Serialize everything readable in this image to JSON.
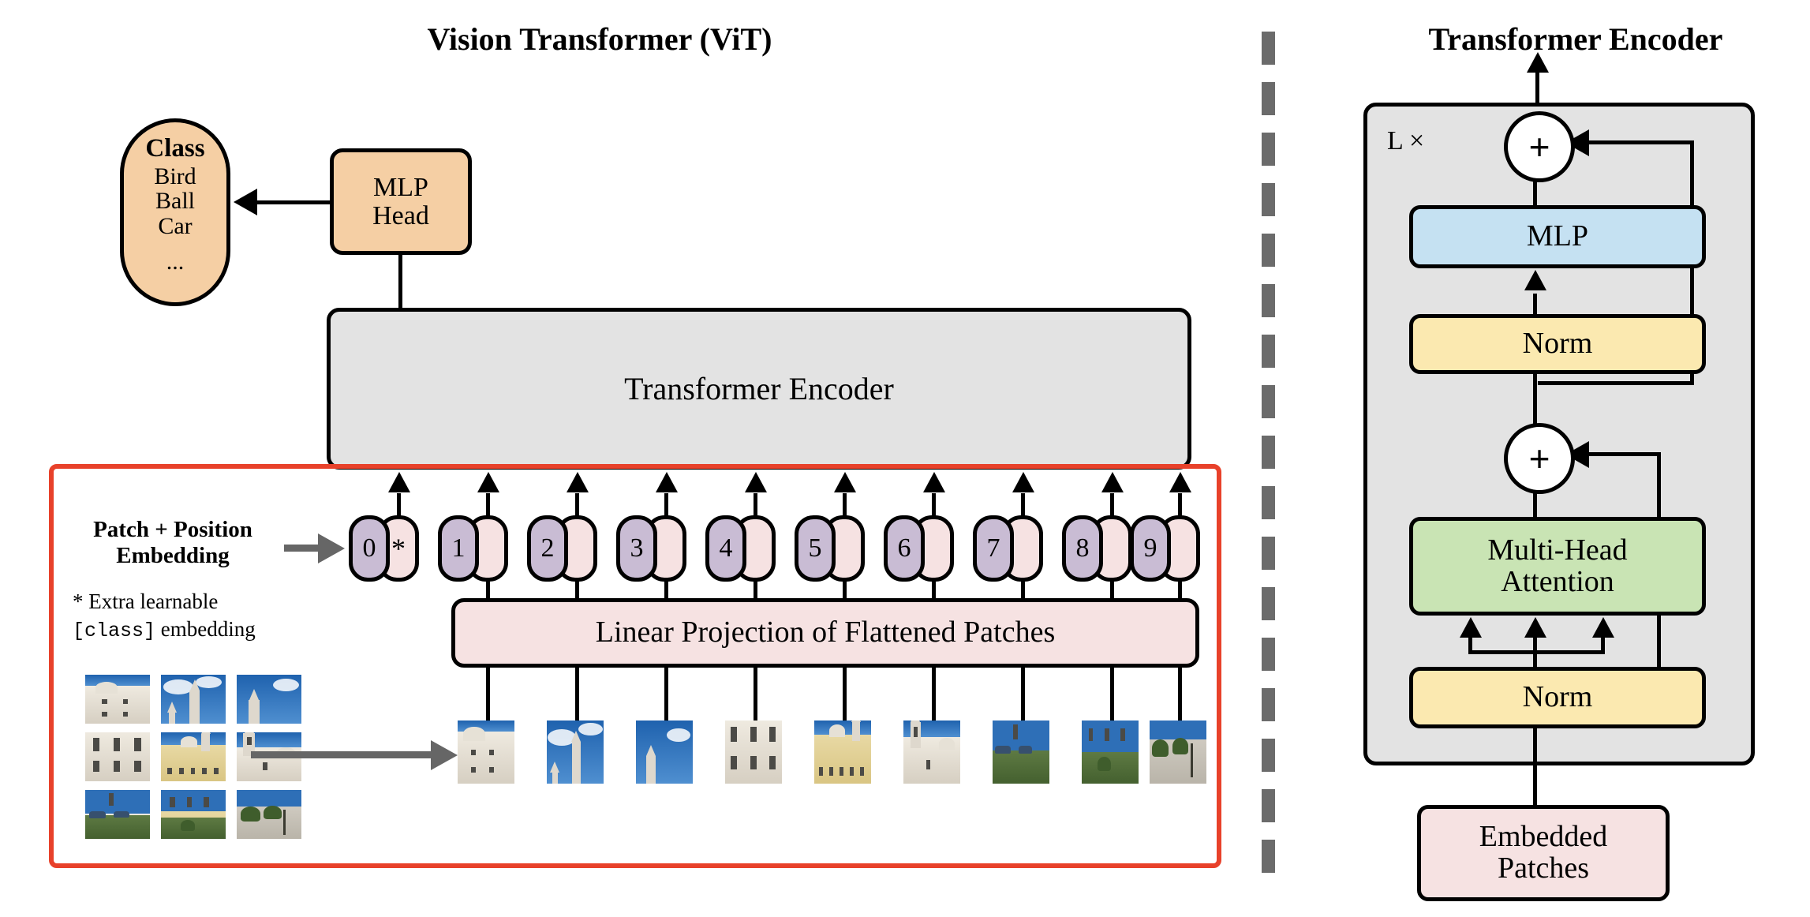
{
  "figure": {
    "left_panel_title": "Vision Transformer (ViT)",
    "right_panel_title": "Transformer Encoder"
  },
  "colors": {
    "orange": "#f5cfa4",
    "pink": "#f6e2e2",
    "gray_box": "#e3e3e3",
    "purple": "#c9bcd4",
    "blue": "#c5e1f2",
    "yellow": "#fbe9b0",
    "green": "#c9e4b4",
    "red_outline": "#e8412a",
    "divider_gray": "#6b6b6b",
    "line_black": "#000000"
  },
  "left": {
    "class_box": {
      "heading": "Class",
      "items": [
        "Bird",
        "Ball",
        "Car"
      ],
      "ellipsis": "..."
    },
    "mlp_head": {
      "line1": "MLP",
      "line2": "Head"
    },
    "transformer_encoder_box": {
      "label": "Transformer Encoder"
    },
    "embedding_label": {
      "line1": "Patch + Position",
      "line2": "Embedding"
    },
    "footnote": {
      "line1_prefix": "* ",
      "line1": "Extra learnable",
      "line2_token": "[class]",
      "line2_rest": " embedding"
    },
    "tokens": [
      {
        "position": "0",
        "patch_mark": "*"
      },
      {
        "position": "1",
        "patch_mark": ""
      },
      {
        "position": "2",
        "patch_mark": ""
      },
      {
        "position": "3",
        "patch_mark": ""
      },
      {
        "position": "4",
        "patch_mark": ""
      },
      {
        "position": "5",
        "patch_mark": ""
      },
      {
        "position": "6",
        "patch_mark": ""
      },
      {
        "position": "7",
        "patch_mark": ""
      },
      {
        "position": "8",
        "patch_mark": ""
      },
      {
        "position": "9",
        "patch_mark": ""
      }
    ],
    "linear_projection": {
      "label": "Linear Projection of Flattened Patches"
    },
    "source_image_alt": "Palace of Mafra photograph split into a 3 by 3 grid of patches",
    "patch_sequence_alt": "Row of nine flattened image patches"
  },
  "right": {
    "repeat_label": "L ×",
    "blocks": {
      "mlp": "MLP",
      "norm_top": "Norm",
      "attention_line1": "Multi-Head",
      "attention_line2": "Attention",
      "norm_bottom": "Norm",
      "embedded_patches_line1": "Embedded",
      "embedded_patches_line2": "Patches"
    },
    "residual_add_symbol": "+"
  }
}
